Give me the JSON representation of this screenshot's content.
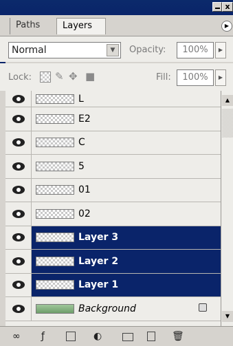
{
  "window": {
    "minimize_icon": "minimize-icon",
    "close_label": "x"
  },
  "tabs": [
    {
      "label": "Paths"
    },
    {
      "label": "Layers"
    }
  ],
  "panel_menu_icon": "arrow-right-icon",
  "blend_mode": {
    "value": "Normal"
  },
  "opacity": {
    "label": "Opacity:",
    "value": "100%"
  },
  "lock": {
    "label": "Lock:"
  },
  "fill": {
    "label": "Fill:",
    "value": "100%"
  },
  "layers": [
    {
      "name": "L",
      "selected": false
    },
    {
      "name": "E2",
      "selected": false
    },
    {
      "name": "C",
      "selected": false
    },
    {
      "name": "5",
      "selected": false
    },
    {
      "name": "01",
      "selected": false
    },
    {
      "name": "02",
      "selected": false
    },
    {
      "name": "Layer 3",
      "selected": true
    },
    {
      "name": "Layer 2",
      "selected": true
    },
    {
      "name": "Layer 1",
      "selected": true
    },
    {
      "name": "Background",
      "selected": false
    }
  ],
  "colors": {
    "selection": "#0a246a",
    "panel": "#eeede9",
    "chrome": "#d6d3ce"
  }
}
